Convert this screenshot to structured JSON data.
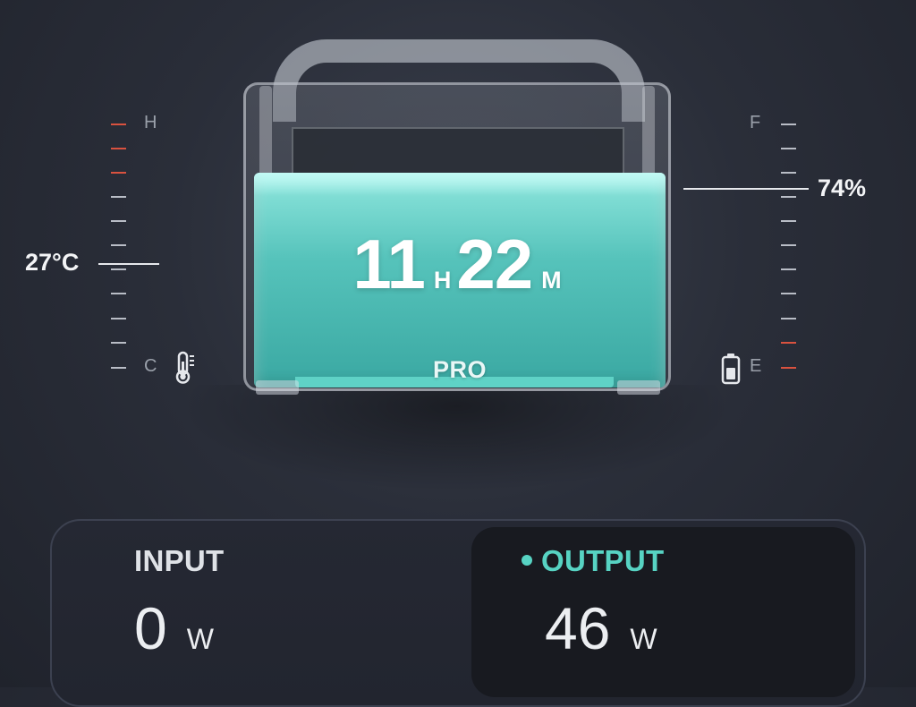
{
  "temperature": {
    "high_label": "H",
    "low_label": "C",
    "reading": "27°C"
  },
  "battery": {
    "full_label": "F",
    "empty_label": "E",
    "reading": "74%",
    "level_fraction": 0.74
  },
  "runtime": {
    "hours": "11",
    "hours_unit": "H",
    "minutes": "22",
    "minutes_unit": "M"
  },
  "device": {
    "model_label": "PRO"
  },
  "input": {
    "label": "INPUT",
    "value": "0",
    "unit": "W"
  },
  "output": {
    "label": "OUTPUT",
    "value": "46",
    "unit": "W",
    "active": true
  },
  "colors": {
    "accent_teal": "#57d3c3",
    "warning_red": "#d9523f",
    "background": "#2a2e39"
  },
  "icons": {
    "temperature": "thermometer-icon",
    "battery": "battery-icon"
  }
}
